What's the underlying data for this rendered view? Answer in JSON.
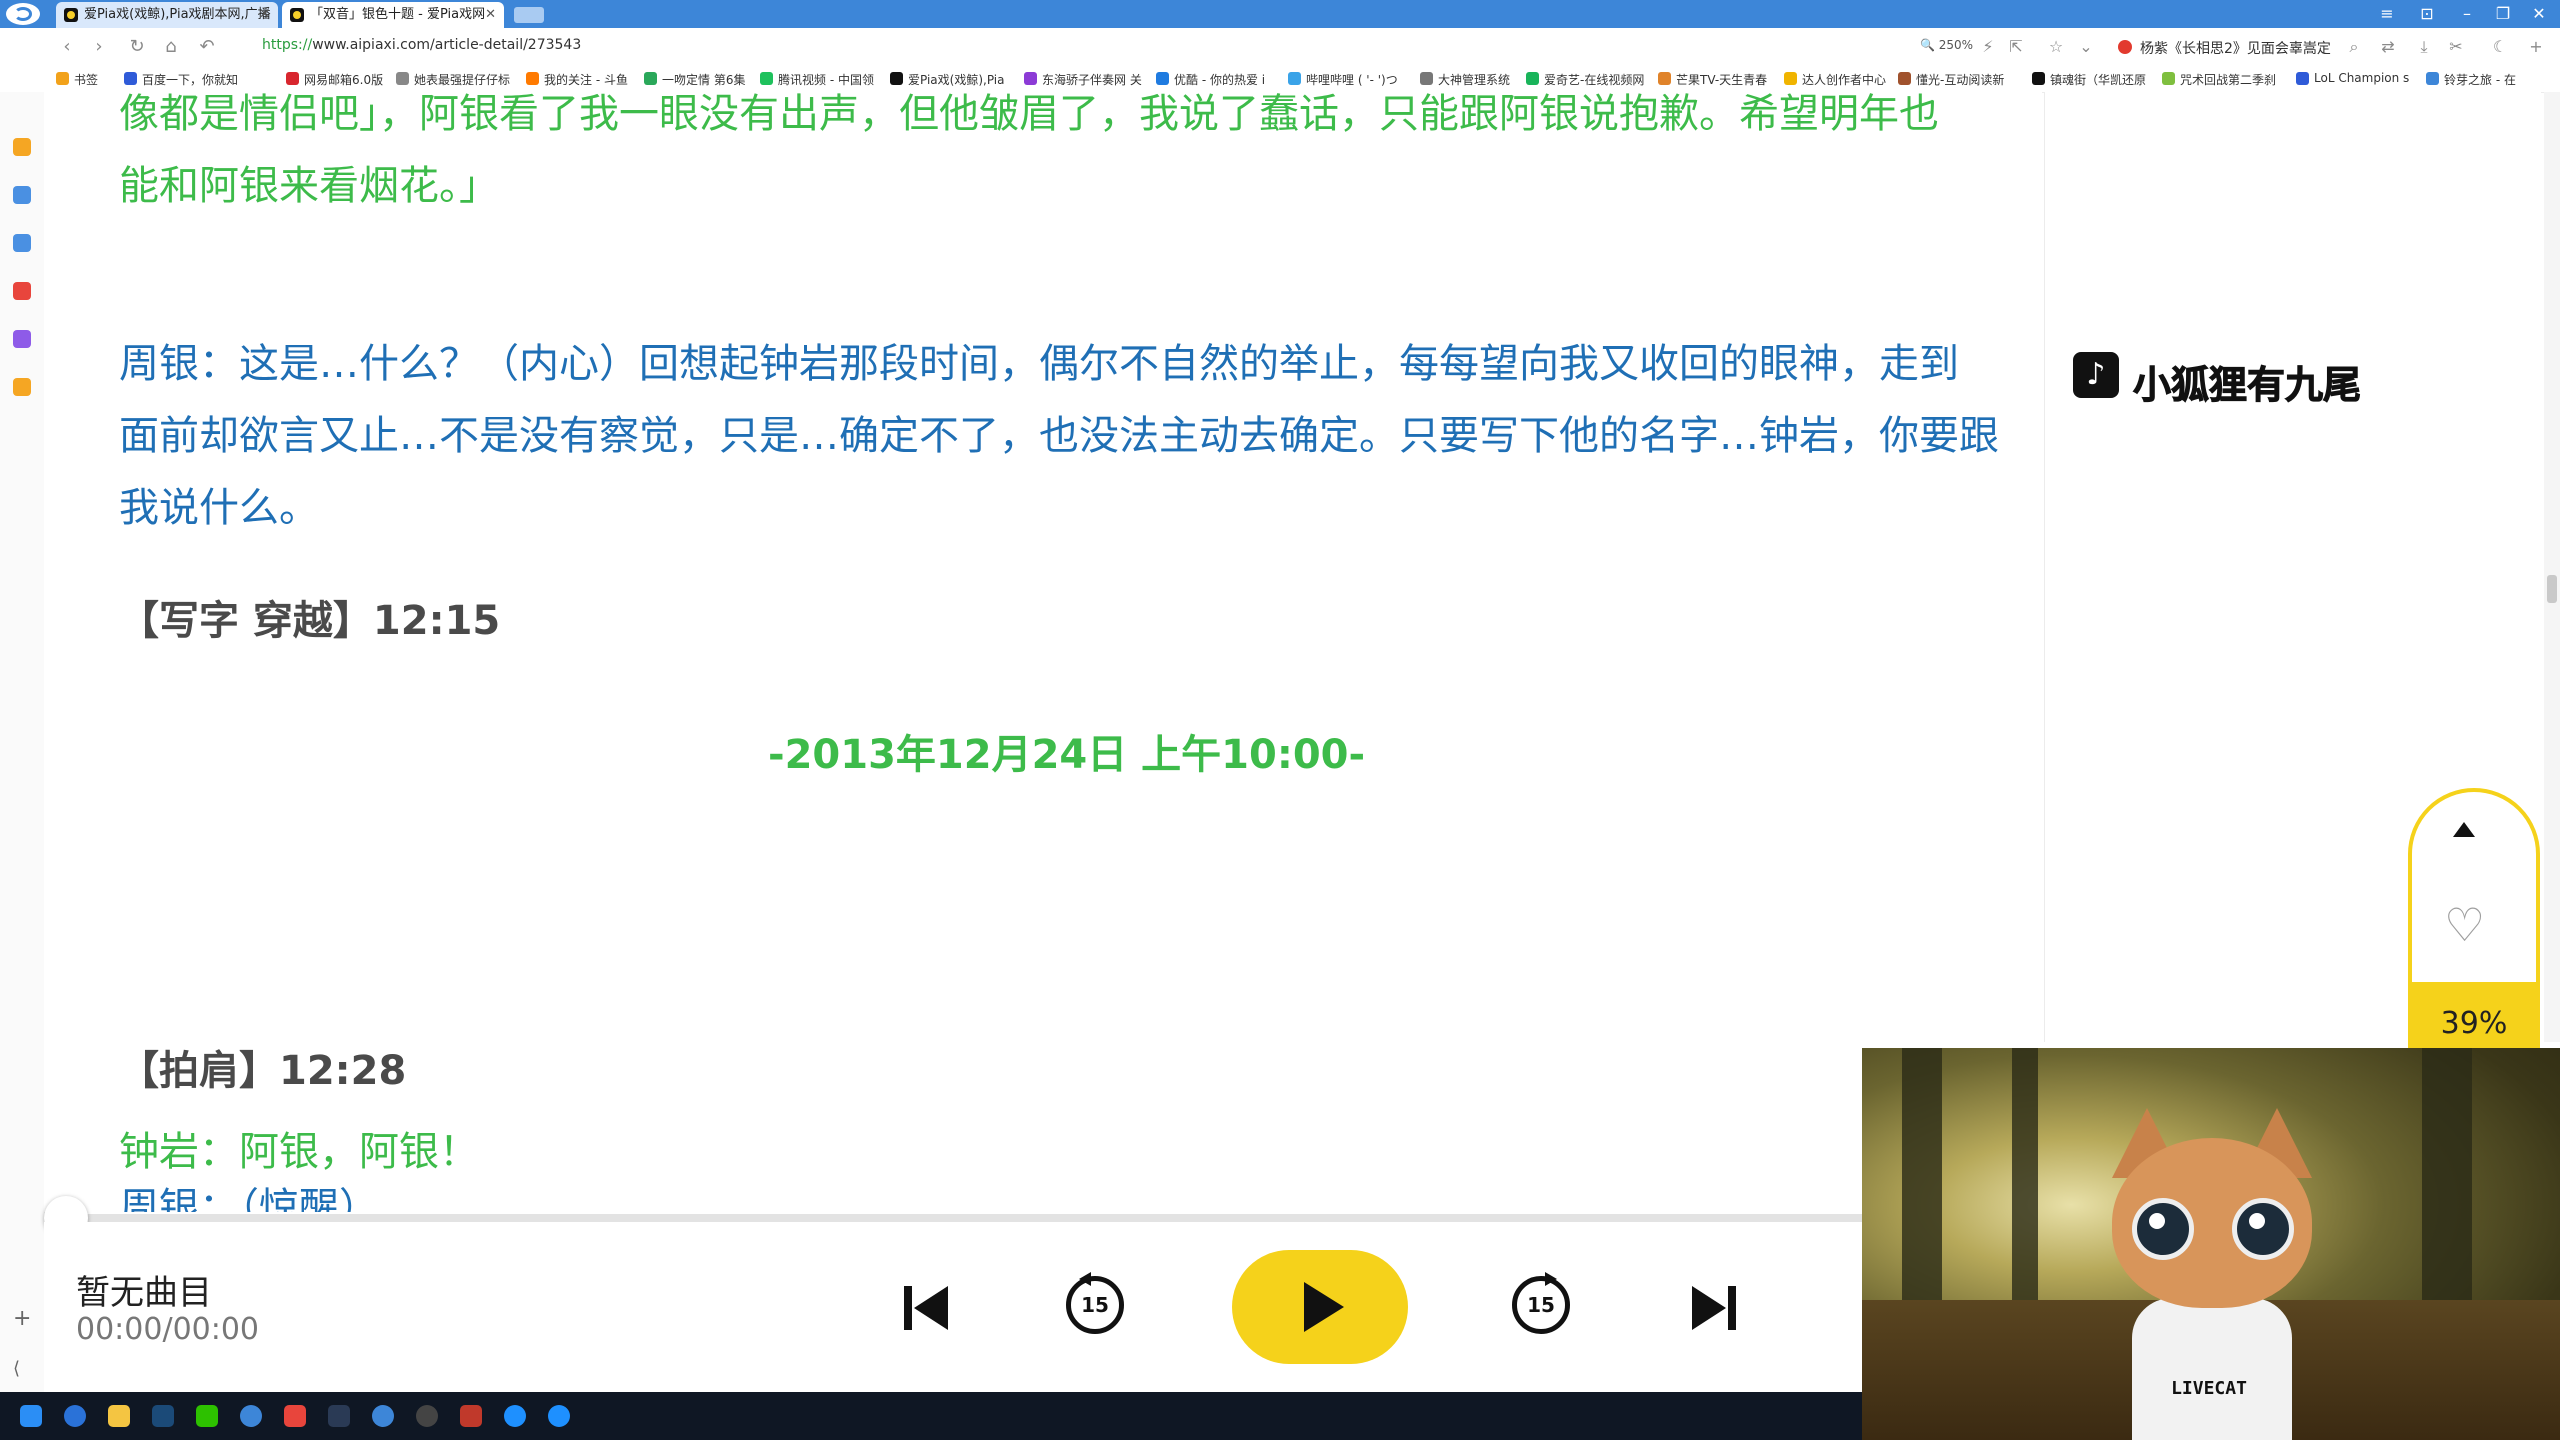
{
  "browser": {
    "tabs": [
      {
        "label": "爱Pia戏(戏鲸),Pia戏剧本网,广播"
      },
      {
        "label": "「双音」银色十题 - 爱Pia戏网"
      }
    ],
    "url_proto": "https://",
    "url_rest": "www.aipiaxi.com/article-detail/273543",
    "zoom": "250%",
    "news": "杨紫《长相思2》见面会辜嵩定",
    "bookmarks": [
      "书签",
      "百度一下，你就知",
      "网易邮箱6.0版",
      "她表最强提仔仔标",
      "我的关注 - 斗鱼",
      "一吻定情 第6集",
      "腾讯视频 - 中国领",
      "爱Pia戏(戏鲸),Pia",
      "东海骄子伴奏网 关",
      "优酷 - 你的热爱 i",
      "哔哩哔哩 ( '- ')つ",
      "大神管理系统",
      "爱奇艺-在线视频网",
      "芒果TV-天生青春",
      "达人创作者中心",
      "懂光-互动阅读新",
      "镇魂街（华凯还原",
      "咒术回战第二季刹",
      "LoL Champion s",
      "铃芽之旅 - 在"
    ]
  },
  "article": {
    "para_top_line1": "像都是情侣吧」，阿银看了我一眼没有出声，但他皱眉了，我说了蠢话，只能跟阿银说抱歉。希望明年也",
    "para_top_line2": "能和阿银来看烟花。」",
    "para_blue_1": "周银：这是…什么？（内心）回想起钟岩那段时间，偶尔不自然的举止，每每望向我又收回的眼神，走到",
    "para_blue_2": "面前却欲言又止…不是没有察觉，只是…确定不了，也没法主动去确定。只要写下他的名字…钟岩，你要跟",
    "para_blue_3": "我说什么。",
    "section1": "【写字 穿越】12:15",
    "dateline": "-2013年12月24日 上午10:00-",
    "section2": "【拍肩】12:28",
    "line_green": "钟岩：阿银，阿银！",
    "line_blue_cut": "周银：（惊醒）"
  },
  "watermark": {
    "icon": "tiktok-icon",
    "text": "小狐狸有九尾"
  },
  "float": {
    "percent": "39%",
    "progress_fraction": 0.39
  },
  "player": {
    "title": "暂无曲目",
    "time": "00:00/00:00",
    "seek_back": "15",
    "seek_fwd": "15",
    "progress_fraction": 0.0
  },
  "colors": {
    "green_text": "#3dbb4a",
    "blue_text": "#1f6fb5",
    "accent_yellow": "#f5d21b",
    "tab_bar": "#3d86d8"
  },
  "camera": {
    "shirt_text": "LIVECAT"
  }
}
